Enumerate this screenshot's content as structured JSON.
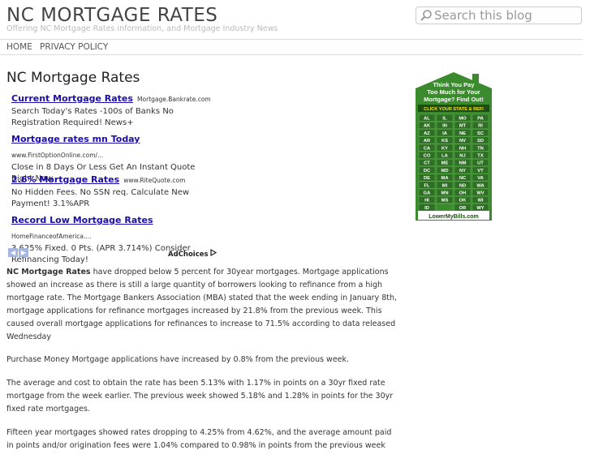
{
  "header": {
    "site_title": "NC MORTGAGE RATES",
    "tagline": "Offering NC Mortgage Rates information, and Mortgage Industry News"
  },
  "search": {
    "placeholder": "Search this blog"
  },
  "nav": {
    "items": [
      "HOME",
      "PRIVACY POLICY"
    ]
  },
  "post": {
    "title": "NC Mortgage Rates"
  },
  "ads": [
    {
      "title": "Current Mortgage Rates",
      "url": "Mortgage.Bankrate.com",
      "line1": "Search Today's Rates -100s of Banks No",
      "line2": "Registration Required! News+"
    },
    {
      "title": "Mortgage rates mn Today",
      "url": "www.FirstOptionOnline.com/...",
      "line1": "Close in 8 Days Or Less Get An Instant Quote",
      "line2": "Right Now"
    },
    {
      "title": "2.6% Mortgage Rates",
      "url": "www.RiteQuote.com",
      "line1": "No Hidden Fees. No SSN req. Calculate New",
      "line2": "Payment! 3.1%APR"
    },
    {
      "title": "Record Low Mortgage Rates",
      "url": "HomeFinanceofAmerica....",
      "line1": "3.625% Fixed. 0 Pts. (APR 3.714%) Consider",
      "line2": "Refinancing Today!"
    }
  ],
  "adchoices_label": "AdChoices",
  "article": {
    "p1_bold": "NC Mortgage Rates",
    "p1_rest": " have dropped below 5 percent for 30year mortgages. Mortgage applications showed an increase as there is still a large quantity of borrowers looking to refinance from a high mortgage rate. The Mortgage Bankers Association (MBA) stated that the week ending in January 8th, mortgage applications for refinance mortgages increased by 21.8% from the previous week. This caused overall mortgage applications for refinances to increase to 71.5% according to data released Wednesday",
    "p2": "Purchase Money Mortgage applications have increased by 0.8% from the previous week.",
    "p3": "The average and cost to obtain the rate has been 5.13% with 1.17% in points on a 30yr fixed rate mortgage from the week earlier. The previous week showed 5.18% and 1.28% in points for the 30yr fixed rate mortgages.",
    "p4": "Fifteen year mortgages showed rates dropping to 4.25% from 4.62%, and the average amount paid in points and/or origination fees were 1.04% compared to 0.98% in points from the previous week"
  },
  "banner": {
    "headline": [
      "Think You Pay",
      "Too Much for Your",
      "Mortgage? Find Out!"
    ],
    "cta": "CLICK YOUR STATE & REFI",
    "states": [
      [
        "AL",
        "IL",
        "MO",
        "PA"
      ],
      [
        "AK",
        "IN",
        "MT",
        "RI"
      ],
      [
        "AZ",
        "IA",
        "NE",
        "SC"
      ],
      [
        "AR",
        "KS",
        "NV",
        "SD"
      ],
      [
        "CA",
        "KY",
        "NH",
        "TN"
      ],
      [
        "CO",
        "LA",
        "NJ",
        "TX"
      ],
      [
        "CT",
        "ME",
        "NM",
        "UT"
      ],
      [
        "DC",
        "MD",
        "NY",
        "VT"
      ],
      [
        "DE",
        "MA",
        "NC",
        "VA"
      ],
      [
        "FL",
        "MI",
        "ND",
        "WA"
      ],
      [
        "GA",
        "MN",
        "OH",
        "WV"
      ],
      [
        "HI",
        "MS",
        "OK",
        "WI"
      ],
      [
        "ID",
        "",
        "OR",
        "WY"
      ]
    ],
    "logo": "LowerMyBills.com",
    "colors": {
      "green": "#3c8a2e",
      "dark": "#1f4d16",
      "yellow": "#ffe300",
      "cell": "#2f6e25"
    }
  }
}
